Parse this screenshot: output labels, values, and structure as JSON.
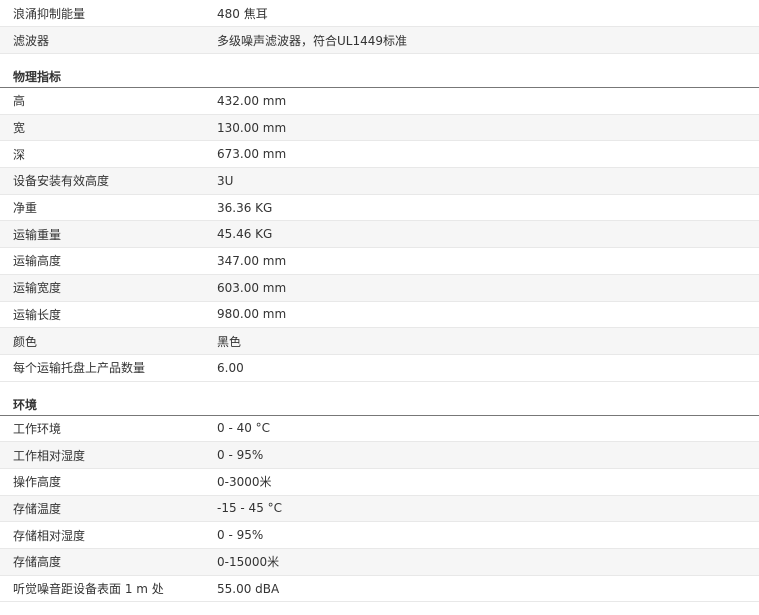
{
  "top_rows": [
    {
      "label": "浪涌抑制能量",
      "value": "480 焦耳"
    },
    {
      "label": "滤波器",
      "value": "多级噪声滤波器，符合UL1449标准"
    }
  ],
  "sections": [
    {
      "title": "物理指标",
      "rows": [
        {
          "label": "高",
          "value": "432.00 mm"
        },
        {
          "label": "宽",
          "value": "130.00 mm"
        },
        {
          "label": "深",
          "value": "673.00 mm"
        },
        {
          "label": "设备安装有效高度",
          "value": "3U"
        },
        {
          "label": "净重",
          "value": "36.36 KG"
        },
        {
          "label": "运输重量",
          "value": "45.46 KG"
        },
        {
          "label": "运输高度",
          "value": "347.00 mm"
        },
        {
          "label": "运输宽度",
          "value": "603.00 mm"
        },
        {
          "label": "运输长度",
          "value": "980.00 mm"
        },
        {
          "label": "颜色",
          "value": "黑色"
        },
        {
          "label": "每个运输托盘上产品数量",
          "value": "6.00"
        }
      ]
    },
    {
      "title": "环境",
      "rows": [
        {
          "label": "工作环境",
          "value": "0 - 40 °C"
        },
        {
          "label": "工作相对湿度",
          "value": "0 - 95%"
        },
        {
          "label": "操作高度",
          "value": "0-3000米"
        },
        {
          "label": "存储温度",
          "value": "-15 - 45 °C"
        },
        {
          "label": "存储相对湿度",
          "value": "0 - 95%"
        },
        {
          "label": "存储高度",
          "value": "0-15000米"
        },
        {
          "label": "听觉噪音距设备表面 1 m 处",
          "value": "55.00 dBA"
        }
      ]
    }
  ]
}
